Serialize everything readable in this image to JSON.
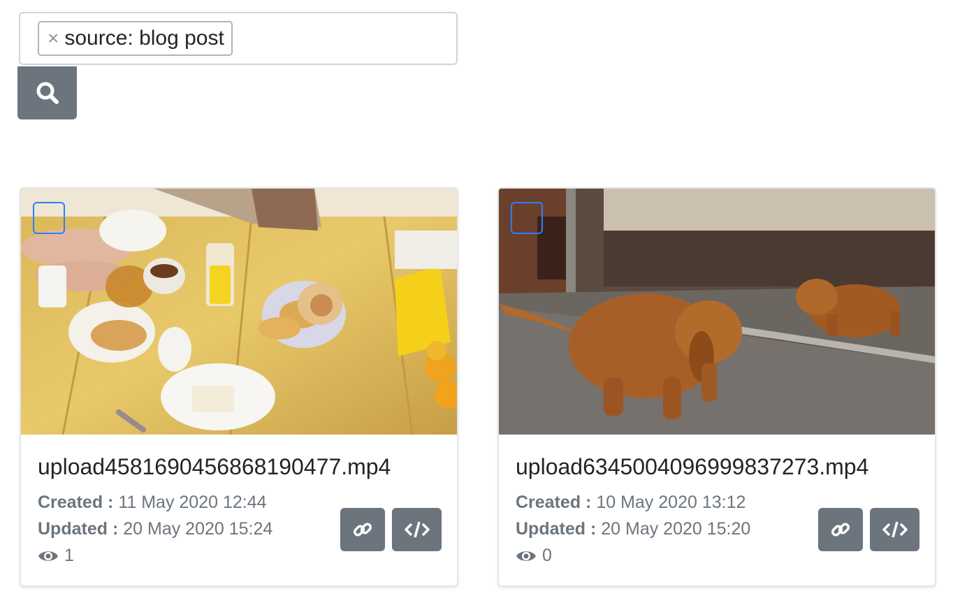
{
  "search": {
    "tag_label": "source: blog post",
    "tag_remove_glyph": "×",
    "search_button_icon": "search-icon"
  },
  "colors": {
    "button_bg": "#6c757d",
    "selection_outline": "#2d7ff9",
    "meta_text": "#6c757d"
  },
  "videos": [
    {
      "filename": "upload4581690456868190477.mp4",
      "created_label": "Created :",
      "created_value": "11 May 2020 12:44",
      "updated_label": "Updated :",
      "updated_value": "20 May 2020 15:24",
      "views": "1",
      "thumbnail": "breakfast table with croissants, tea and orange juice"
    },
    {
      "filename": "upload6345004096999837273.mp4",
      "created_label": "Created :",
      "created_value": "10 May 2020 13:12",
      "updated_label": "Updated :",
      "updated_value": "20 May 2020 15:20",
      "views": "0",
      "thumbnail": "dachshund puppy looking at reflection in mirror"
    }
  ],
  "actions": {
    "link_icon": "link-icon",
    "embed_icon": "code-icon"
  }
}
